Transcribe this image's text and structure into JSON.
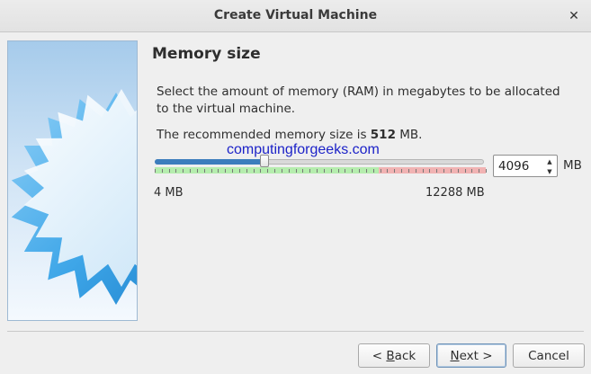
{
  "window": {
    "title": "Create Virtual Machine",
    "close_icon": "close-icon"
  },
  "page": {
    "heading": "Memory size",
    "description": "Select the amount of memory (RAM) in megabytes to be allocated to the virtual machine.",
    "recommended_prefix": "The recommended memory size is ",
    "recommended_value": "512",
    "recommended_suffix": " MB.",
    "watermark": "computingforgeeks.com"
  },
  "memory": {
    "value": "4096",
    "unit": "MB",
    "min_label": "4 MB",
    "max_label": "12288 MB",
    "min_mb": 4,
    "max_mb": 12288,
    "current_mb": 4096,
    "recommended_limit_mb": 8300,
    "colors": {
      "fill": "#3c7dbd",
      "safe": "#b5edae",
      "unsafe": "#f1b3b3"
    }
  },
  "buttons": {
    "back_prefix": "< ",
    "back_mnemonic": "B",
    "back_rest": "ack",
    "next_mnemonic": "N",
    "next_rest": "ext >",
    "cancel": "Cancel"
  }
}
